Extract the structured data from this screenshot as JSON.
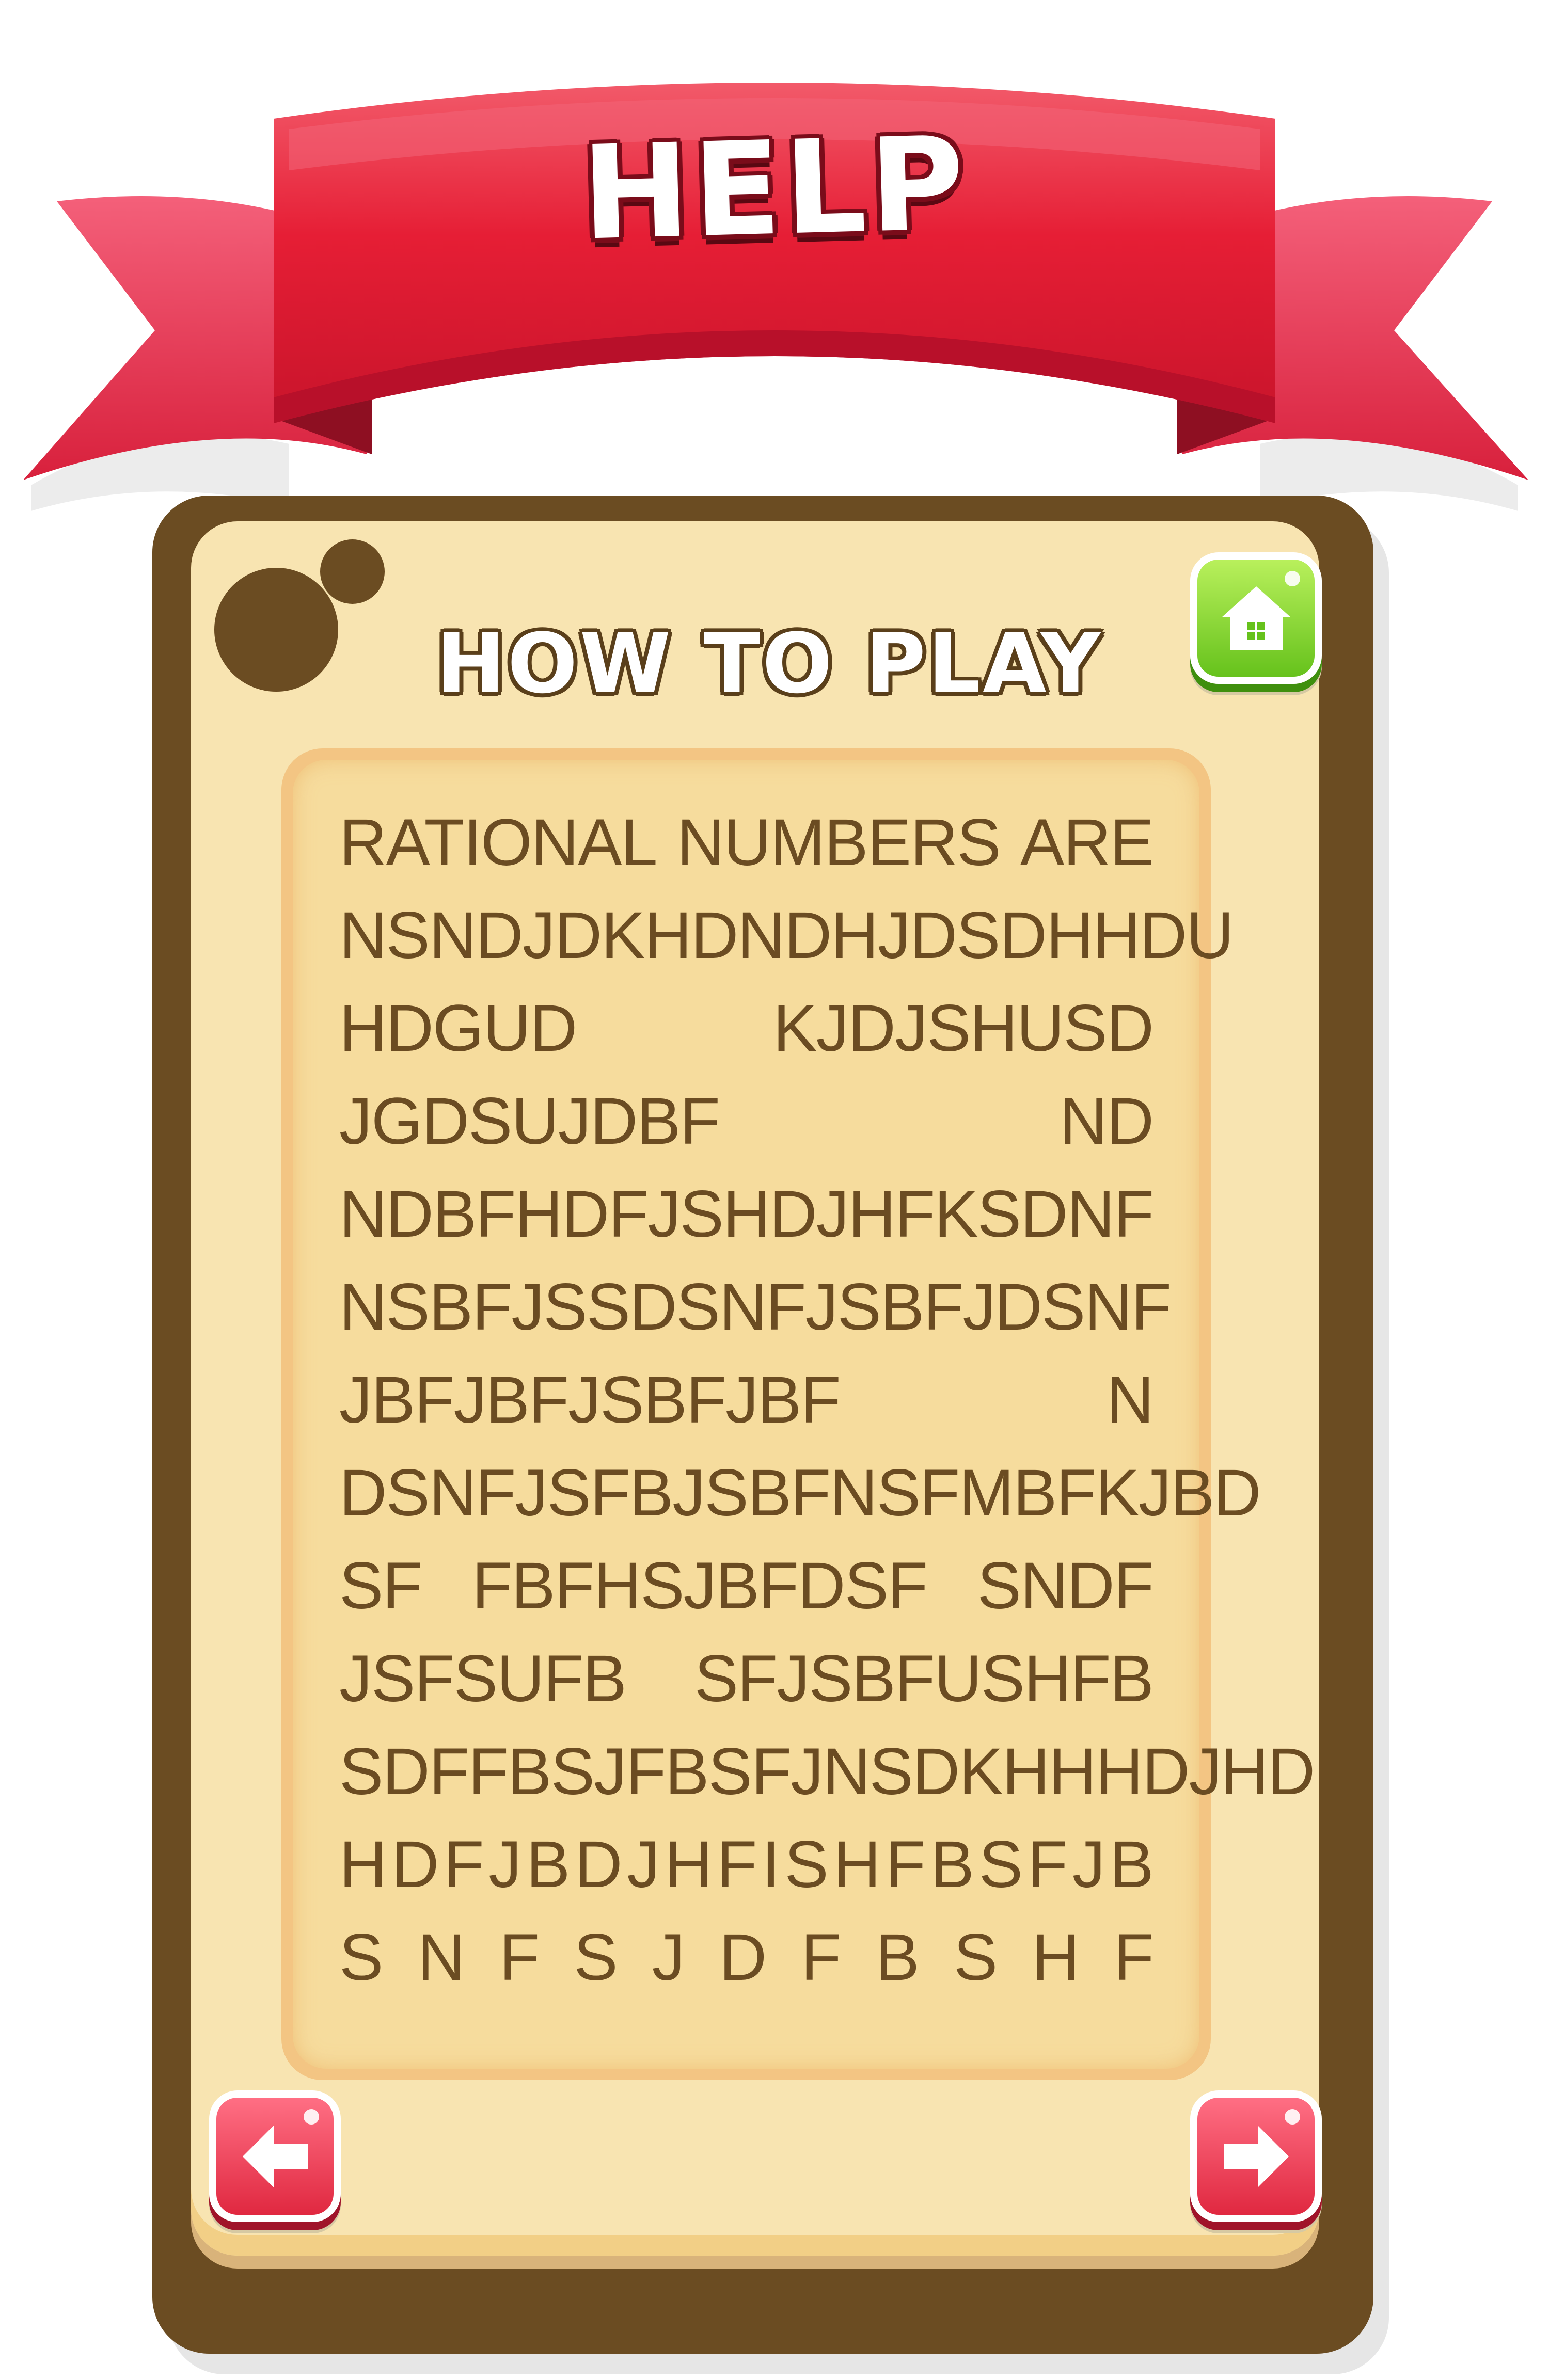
{
  "banner": {
    "title": "HELP"
  },
  "panel": {
    "title": "HOW TO PLAY",
    "buttons": {
      "home_icon": "home-icon",
      "prev_icon": "arrow-left-icon",
      "next_icon": "arrow-right-icon"
    }
  },
  "instructions": {
    "lines": [
      [
        "RATIONAL",
        "NUMBERS",
        "ARE"
      ],
      [
        "NSNDJDKHD",
        "NDHJD",
        "SDHHDU"
      ],
      [
        "HDGUD",
        "KJDJSHUSD"
      ],
      [
        "JGDSUJDBF",
        "ND"
      ],
      [
        "NDBFHDFJSHDJHFK",
        "SDNF"
      ],
      [
        "NSBFJSS",
        "DSN",
        "FJSBFJD",
        "SNF"
      ],
      [
        "JBFJBFJSBFJBF",
        "N"
      ],
      [
        "DSNFJSFBJSBF",
        "NSFMB",
        "FKJBD"
      ],
      [
        "SF",
        "FBFHSJBFDSF",
        "SNDF"
      ],
      [
        "JSFSUFB",
        "SFJSBFUSHFB"
      ],
      [
        "SDFFBSJFBSFJ",
        "NSDKHH",
        "HDJHD"
      ],
      [
        "H",
        "D",
        "F",
        "J",
        "B",
        "D",
        "J",
        "H",
        "F",
        "I",
        "S",
        "H",
        "F",
        "B",
        "S",
        "F",
        "J",
        "B"
      ],
      [
        "S",
        "N",
        "F",
        "S",
        "J",
        "D",
        "F",
        "B",
        "S",
        "H",
        "F"
      ]
    ]
  },
  "colors": {
    "ribbon_red": "#e61e35",
    "wood_brown": "#6b4c22",
    "panel_cream": "#f8e4b1",
    "textbox_bg": "#f6dc9d",
    "home_green": "#7ad62a",
    "button_red": "#f04058"
  }
}
